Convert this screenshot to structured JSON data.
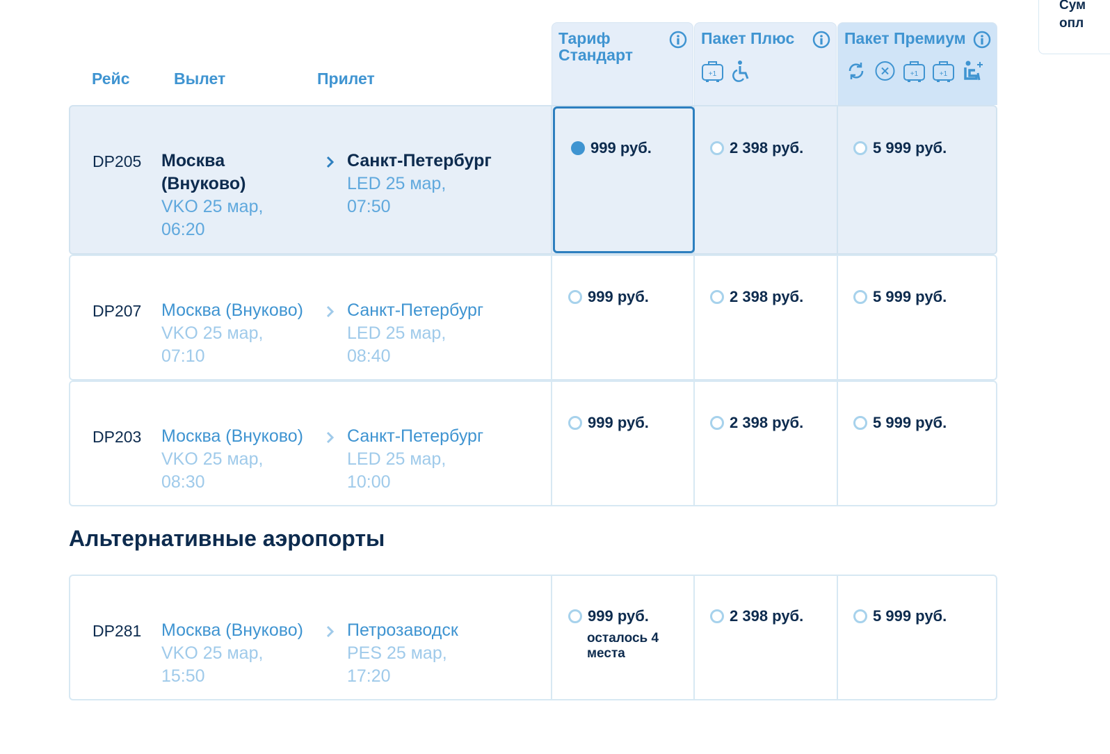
{
  "summary": {
    "line1": "Сум",
    "line2": "опл"
  },
  "header": {
    "flight": "Рейс",
    "departure": "Вылет",
    "arrival": "Прилет"
  },
  "tariffs": [
    {
      "title": "Тариф Стандарт",
      "icons": []
    },
    {
      "title": "Пакет Плюс",
      "icons": [
        "luggage-plus-one-icon",
        "wheelchair-icon"
      ]
    },
    {
      "title": "Пакет Премиум",
      "icons": [
        "exchange-icon",
        "cancel-icon",
        "luggage-plus-one-icon",
        "luggage-plus-one-icon",
        "seat-plus-icon"
      ]
    }
  ],
  "flights": [
    {
      "number": "DP205",
      "from_city": "Москва (Внуково)",
      "from_detail": "VKO 25 мар, 06:20",
      "to_city": "Санкт-Петербург",
      "to_detail": "LED 25 мар, 07:50",
      "prices": [
        "999 руб.",
        "2 398 руб.",
        "5 999 руб."
      ],
      "selected_tariff": 0
    },
    {
      "number": "DP207",
      "from_city": "Москва (Внуково)",
      "from_detail": "VKO 25 мар, 07:10",
      "to_city": "Санкт-Петербург",
      "to_detail": "LED 25 мар, 08:40",
      "prices": [
        "999 руб.",
        "2 398 руб.",
        "5 999 руб."
      ]
    },
    {
      "number": "DP203",
      "from_city": "Москва (Внуково)",
      "from_detail": "VKO 25 мар, 08:30",
      "to_city": "Санкт-Петербург",
      "to_detail": "LED 25 мар, 10:00",
      "prices": [
        "999 руб.",
        "2 398 руб.",
        "5 999 руб."
      ]
    }
  ],
  "alternative": {
    "title": "Альтернативные аэропорты",
    "flights": [
      {
        "number": "DP281",
        "from_city": "Москва (Внуково)",
        "from_detail": "VKO 25 мар, 15:50",
        "to_city": "Петрозаводск",
        "to_detail": "PES 25 мар, 17:20",
        "prices": [
          "999 руб.",
          "2 398 руб.",
          "5 999 руб."
        ],
        "note": "осталось 4 места"
      }
    ]
  },
  "colors": {
    "accent": "#3f94d1",
    "text_dark": "#0d2b4e",
    "muted": "#9fcaea",
    "selected_bg": "#e7eff8",
    "premium_header_bg": "#d0e4f7"
  }
}
